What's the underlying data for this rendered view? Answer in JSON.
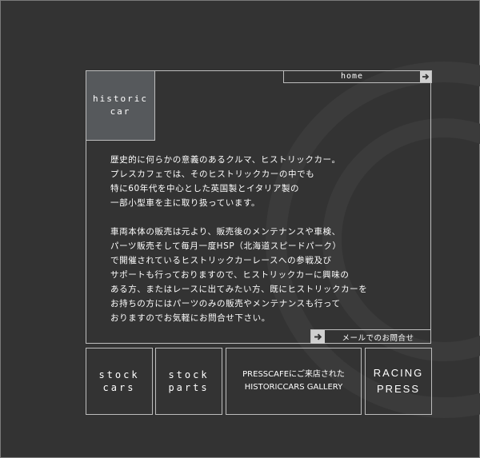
{
  "header": {
    "home_label": "home"
  },
  "title_box": {
    "line1": "historic",
    "line2": "car"
  },
  "intro": {
    "para1": [
      "歴史的に何らかの意義のあるクルマ、ヒストリックカー。",
      "プレスカフェでは、そのヒストリックカーの中でも",
      "特に60年代を中心とした英国製とイタリア製の",
      "一部小型車を主に取り扱っています。"
    ],
    "para2": [
      "車両本体の販売は元より、販売後のメンテナンスや車検、",
      "パーツ販売そして毎月一度HSP（北海道スピードパーク）",
      "で開催されているヒストリックカーレースへの参戦及び",
      "サポートも行っておりますので、ヒストリックカーに興味の",
      "ある方、またはレースに出てみたい方、既にヒストリックカーを",
      "お持ちの方にはパーツのみの販売やメンテナンスも行って",
      "おりますのでお気軽にお問合せ下さい。"
    ]
  },
  "mail": {
    "label": "メールでのお問合せ"
  },
  "nav": {
    "stock_cars": [
      "stock",
      "cars"
    ],
    "stock_parts": [
      "stock",
      "parts"
    ],
    "gallery": [
      "PRESSCAFEにご来店された",
      "HISTORICCARS GALLERY"
    ],
    "racing": [
      "RACING",
      "PRESS"
    ]
  },
  "colors": {
    "background": "#333333",
    "title_box": "#56595c",
    "border": "#bdbdbd",
    "arrow_box": "#d0d0d0",
    "ring": "#3c3c3c"
  },
  "icons": {
    "home_arrow": "arrow-right-icon",
    "mail_arrow": "arrow-right-icon"
  }
}
